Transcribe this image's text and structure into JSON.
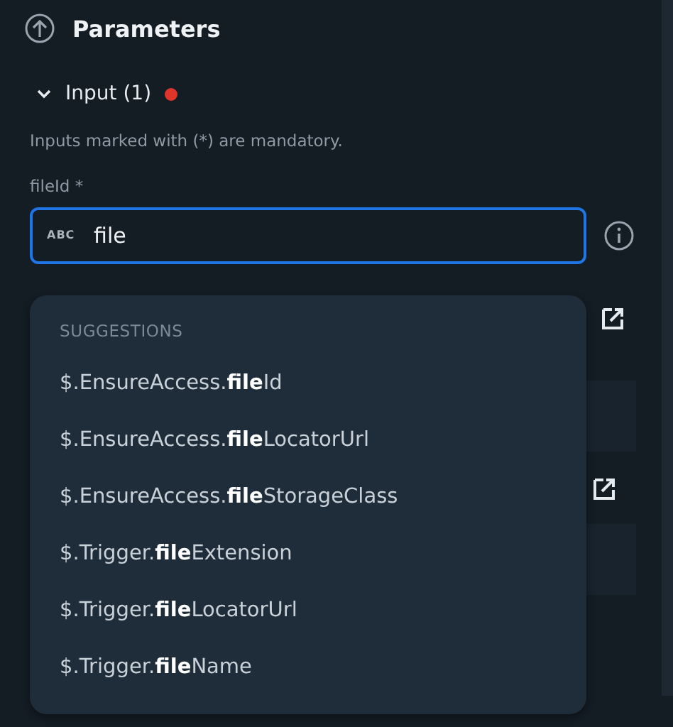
{
  "section": {
    "title": "Parameters"
  },
  "group": {
    "label": "Input (1)",
    "expanded": true,
    "has_error": true,
    "hint": "Inputs marked with (*) are mandatory."
  },
  "field": {
    "label": "fileId *",
    "type_badge": "ABC",
    "value": "file",
    "focused": true
  },
  "suggestions": {
    "heading": "SUGGESTIONS",
    "items": [
      {
        "text": "$.EnsureAccess.**file**Id"
      },
      {
        "text": "$.EnsureAccess.**file**LocatorUrl"
      },
      {
        "text": "$.EnsureAccess.**file**StorageClass"
      },
      {
        "text": "$.Trigger.**file**Extension"
      },
      {
        "text": "$.Trigger.**file**LocatorUrl"
      },
      {
        "text": "$.Trigger.**file**Name"
      }
    ]
  }
}
